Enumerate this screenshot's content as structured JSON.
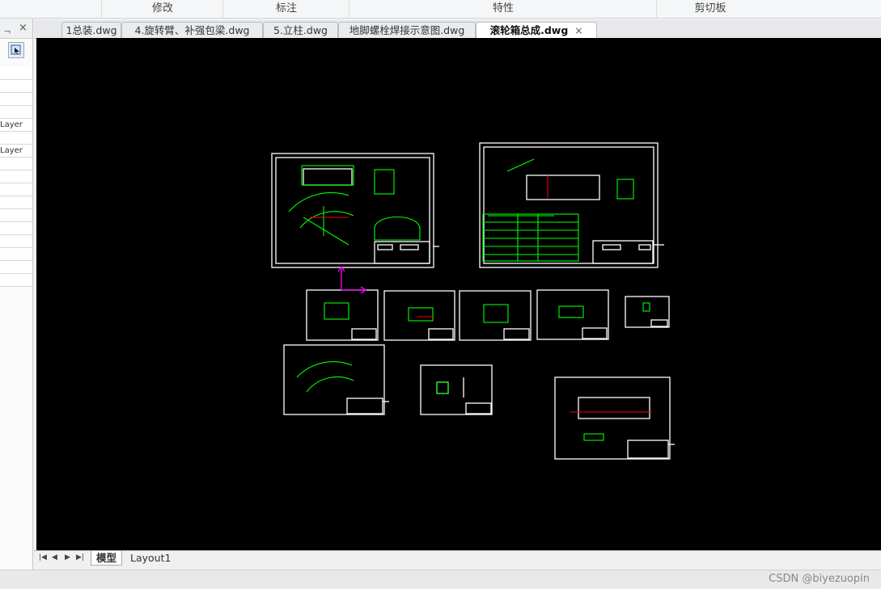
{
  "ribbon": {
    "groups": [
      "修改",
      "标注",
      "特性",
      "剪切板"
    ]
  },
  "left_panel": {
    "rows": [
      "",
      "",
      "",
      "",
      "Layer",
      "",
      "Layer",
      "",
      "",
      "",
      "",
      "",
      "",
      "",
      "",
      "",
      "",
      ""
    ]
  },
  "tabs": [
    {
      "label": "1总装.dwg"
    },
    {
      "label": "4.旋转臂、补强包梁.dwg"
    },
    {
      "label": "5.立柱.dwg"
    },
    {
      "label": "地脚螺栓焊接示意图.dwg"
    },
    {
      "label": "滚轮箱总成.dwg",
      "close": "×"
    }
  ],
  "layout_tabs": [
    "模型",
    "Layout1"
  ],
  "watermark": "CSDN @biyezuopin",
  "colors": {
    "canvas_bg": "#000000",
    "drawing_line": "#ffffff",
    "geometry": "#00ff00",
    "centerline": "#ff0000",
    "ucs": "#ff00ff"
  }
}
